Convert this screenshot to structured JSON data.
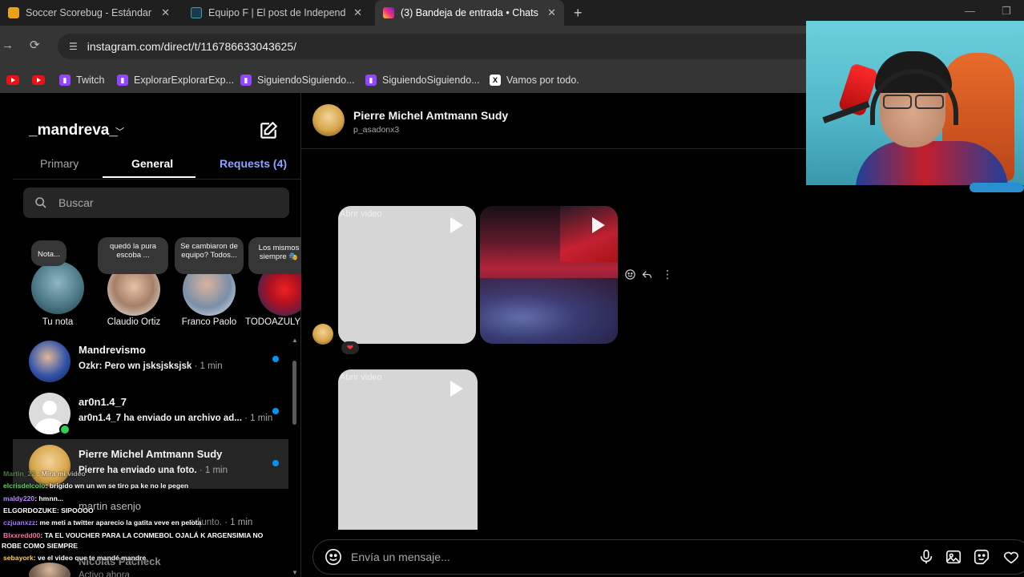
{
  "browser": {
    "tabs": [
      {
        "title": "Soccer Scorebug - Estándar - A",
        "active": false
      },
      {
        "title": "Equipo F | El post de Independ",
        "active": false
      },
      {
        "title": "(3) Bandeja de entrada • Chats",
        "active": true
      }
    ],
    "url": "instagram.com/direct/t/116786633043625/",
    "bookmarks": [
      {
        "label": "Twitch",
        "icon": "twitch-icon"
      },
      {
        "label": "ExplorarExplorarExp...",
        "icon": "twitch-icon"
      },
      {
        "label": "SiguiendoSiguiendo...",
        "icon": "twitch-icon"
      },
      {
        "label": "SiguiendoSiguiendo...",
        "icon": "twitch-icon"
      },
      {
        "label": "Vamos por todo.",
        "icon": "x-icon"
      }
    ]
  },
  "inbox": {
    "username": "_mandreva_",
    "tabs": {
      "primary": "Primary",
      "general": "General",
      "requests": "Requests (4)"
    },
    "search_placeholder": "Buscar",
    "notes": [
      {
        "bubble": "Nota...",
        "name": "Tu nota"
      },
      {
        "bubble": "quedó la pura escoba ...",
        "name": "Claudio Ortiz"
      },
      {
        "bubble": "Se cambiaron de equipo? Todos...",
        "name": "Franco Paolo"
      },
      {
        "bubble": "Los mismos siempre 🎭",
        "name": "TODOAZULYR"
      }
    ],
    "conversations": [
      {
        "name": "Mandrevismo",
        "message": "Ozkr: Pero wn jsksjsksjsk",
        "time": "· 1 min",
        "unread": true
      },
      {
        "name": "ar0n1.4_7",
        "message": "ar0n1.4_7 ha enviado un archivo ad...",
        "time": "· 1 min",
        "unread": true
      },
      {
        "name": "Pierre Michel Amtmann Sudy",
        "message": "Pierre ha enviado una foto.",
        "time": "· 1 min",
        "unread": true
      },
      {
        "name": "martin asenjo",
        "message": "adjunto.",
        "time": "· 1 min",
        "unread": false
      },
      {
        "name": "Nicolas Pacheck",
        "message": "Activo ahora",
        "time": "",
        "unread": false
      }
    ]
  },
  "chat_overlay": [
    {
      "user": "Martin_22",
      "text": "Mira mi video",
      "color": "#7fbf6f"
    },
    {
      "user": "elcrisdelcolo",
      "text": ": brigido wn un wn se tiro pa ke no le pegen",
      "color": "#5fd35f"
    },
    {
      "user": "maldy220",
      "text": ": hmnn...",
      "color": "#b78cff"
    },
    {
      "user": "ELGORDOZUKE",
      "text": ": SIPOOOO",
      "color": "#ffffff"
    },
    {
      "user": "czjuanxzz",
      "text": ": me meti a twitter aparecio la gatita veve en pelota",
      "color": "#9f7bff"
    },
    {
      "user": "Blxxredd00",
      "text": ": TA EL VOUCHER PARA LA CONMEBOL OJALÁ K ARGENSIMIA NO",
      "color": "#ff6fa8"
    },
    {
      "user": "",
      "text": "ROBE COMO SIEMPRE",
      "color": "#ffffff"
    },
    {
      "user": "sebayork",
      "text": ": ve el video que te mandé mandre",
      "color": "#ffd34d"
    }
  ],
  "thread": {
    "name": "Pierre Michel Amtmann Sudy",
    "handle": "p_asadonx3",
    "alt_text": "Abrir video",
    "reaction": "❤",
    "composer_placeholder": "Envía un mensaje..."
  }
}
